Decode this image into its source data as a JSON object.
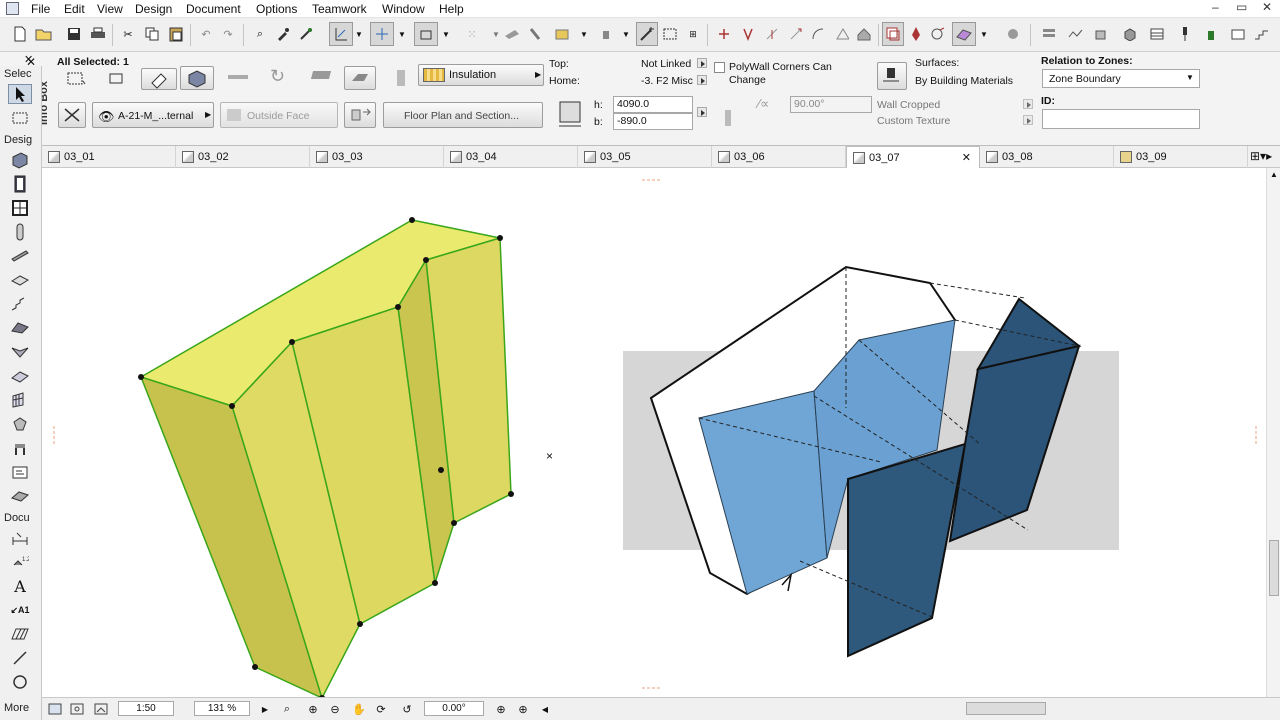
{
  "menubar": {
    "items": [
      "File",
      "Edit",
      "View",
      "Design",
      "Document",
      "Options",
      "Teamwork",
      "Window",
      "Help"
    ],
    "window_buttons": [
      "–",
      "▭",
      "✕"
    ]
  },
  "toolbox": {
    "select_label": "Selec",
    "design_label": "Desig",
    "document_label": "Docu",
    "more_label": "More"
  },
  "infobox": {
    "panel_label": "Info Box",
    "all_selected": "All Selected: 1",
    "material_name": "Insulation",
    "top_label": "Top:",
    "top_value": "Not Linked",
    "home_label": "Home:",
    "home_value": "-3. F2 Misc",
    "polywall_label": "PolyWall Corners Can Change",
    "surfaces_label": "Surfaces:",
    "surfaces_value": "By Building Materials",
    "relation_label": "Relation to Zones:",
    "relation_value": "Zone Boundary",
    "layer_value": "A-21-M_...ternal",
    "reference_face": "Outside Face",
    "floor_plan_button": "Floor Plan and Section...",
    "h_label": "h:",
    "h_value": "4090.0",
    "b_label": "b:",
    "b_value": "-890.0",
    "angle_value": "90.00°",
    "wall_cropped": "Wall Cropped",
    "custom_texture": "Custom Texture",
    "id_label": "ID:",
    "id_value": ""
  },
  "tabs": [
    {
      "label": "03_01"
    },
    {
      "label": "03_02"
    },
    {
      "label": "03_03"
    },
    {
      "label": "03_04"
    },
    {
      "label": "03_05"
    },
    {
      "label": "03_06"
    },
    {
      "label": "03_07",
      "active": true
    },
    {
      "label": "03_08"
    },
    {
      "label": "03_09"
    }
  ],
  "statusbar": {
    "scale": "1:50",
    "zoom": "131 %",
    "angle": "0.00°"
  },
  "colors": {
    "wall_yellow": "#e9e36a",
    "wall_yellow_dark": "#c4bf4a",
    "wall_outline": "#3aa61a",
    "light_blue": "#6fa6d6",
    "dark_blue": "#2b5478",
    "grey_plane": "#d6d6d6"
  }
}
